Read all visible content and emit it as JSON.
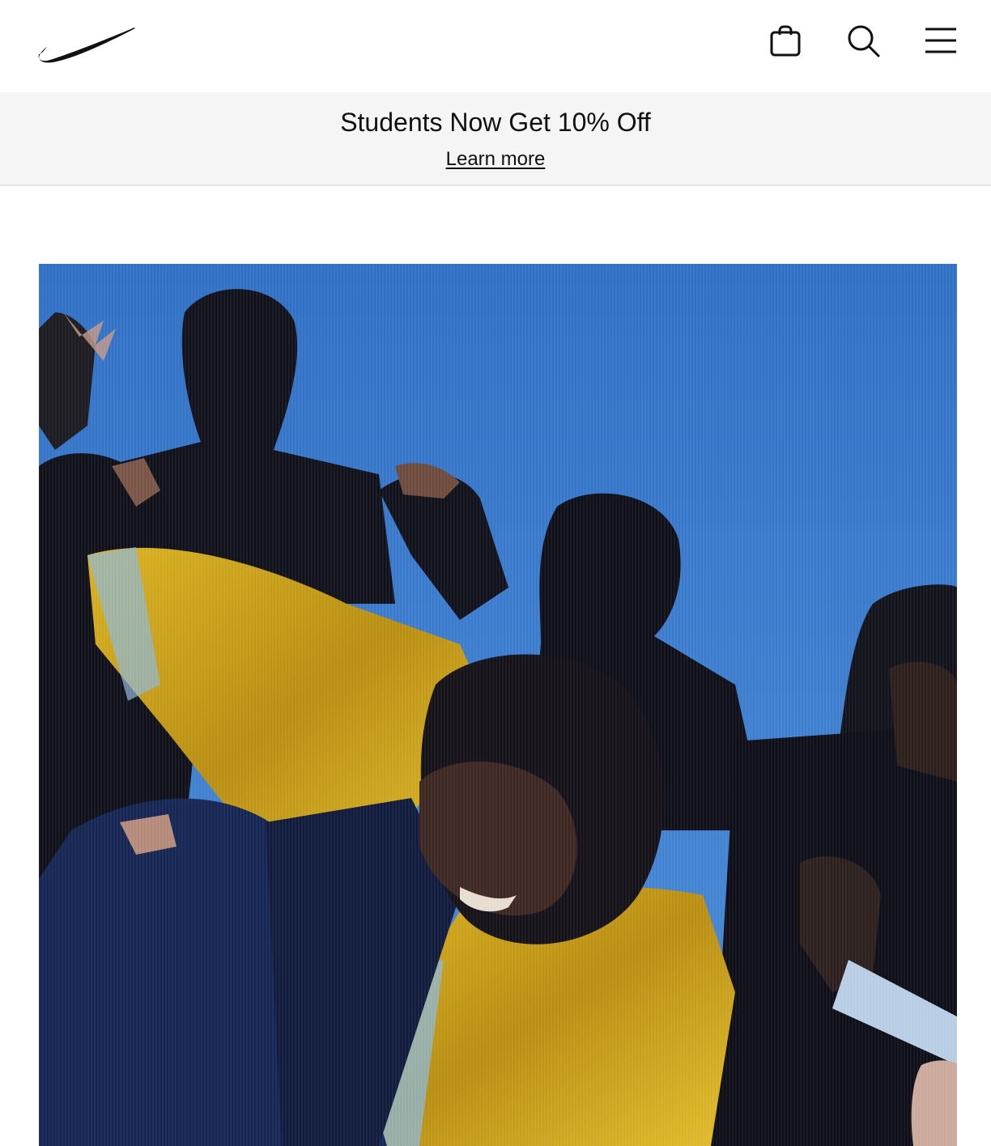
{
  "header": {
    "logo_icon": "nike-swoosh-icon",
    "icons": [
      "shopping-bag-icon",
      "search-icon",
      "menu-icon"
    ]
  },
  "promo": {
    "title": "Students Now Get 10% Off",
    "link_label": "Learn more"
  },
  "hero": {
    "description_icon": "hero-photo",
    "colors": {
      "sky": "#3d7bd0",
      "dark": "#0e0f18",
      "jacket": "#c9a317",
      "navy": "#142552"
    }
  }
}
